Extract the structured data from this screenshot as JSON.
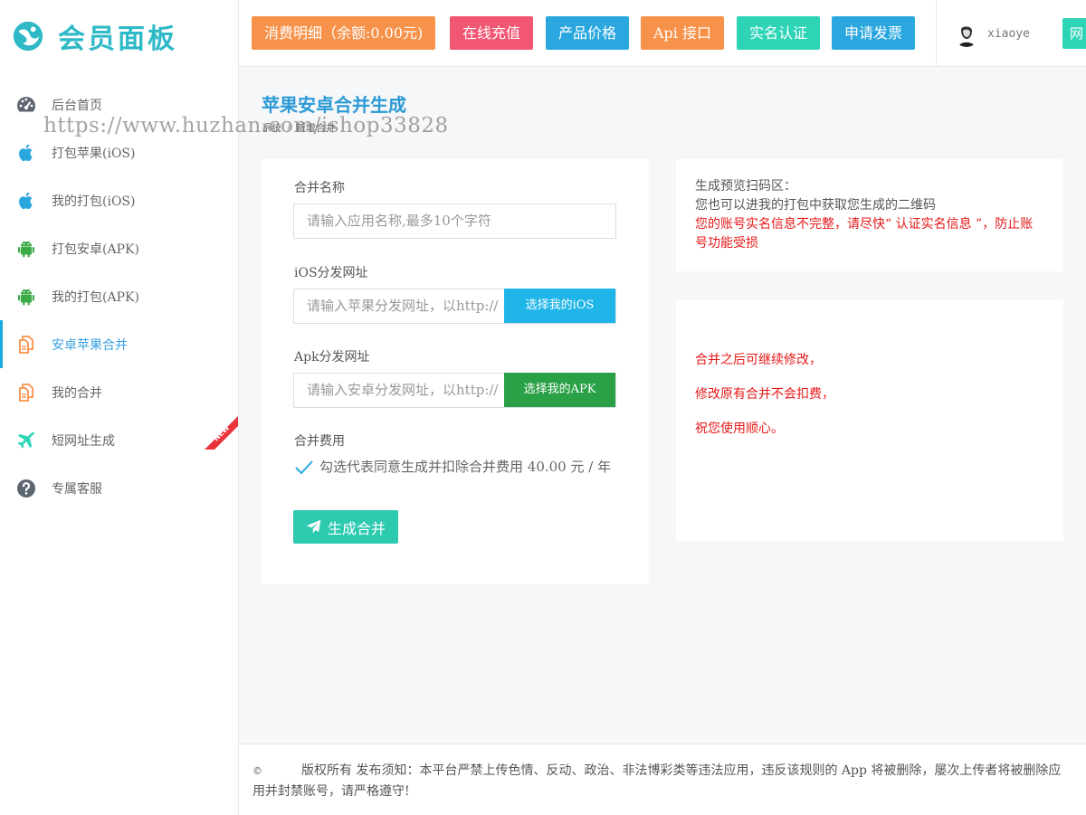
{
  "brand": {
    "title": "会员面板",
    "color": "#2fb9c7"
  },
  "watermark": "https://www.huzhan.com/ishop33828",
  "sidebar": {
    "items": [
      {
        "label": "后台首页",
        "icon": "dashboard-icon"
      },
      {
        "label": "打包苹果(iOS)",
        "icon": "apple-icon"
      },
      {
        "label": "我的打包(iOS)",
        "icon": "apple-icon"
      },
      {
        "label": "打包安卓(APK)",
        "icon": "android-icon"
      },
      {
        "label": "我的打包(APK)",
        "icon": "android-icon"
      },
      {
        "label": "安卓苹果合并",
        "icon": "merge-copy-icon",
        "active": true
      },
      {
        "label": "我的合并",
        "icon": "merge-copy-icon"
      },
      {
        "label": "短网址生成",
        "icon": "plane-icon",
        "badge": "NEW"
      },
      {
        "label": "专属客服",
        "icon": "help-circle-icon"
      }
    ]
  },
  "header": {
    "buttons": [
      {
        "label": "消费明细（余额:0.00元)",
        "color": "#f7924a"
      },
      {
        "label": "在线充值",
        "color": "#f15672"
      },
      {
        "label": "产品价格",
        "color": "#2aa7de"
      },
      {
        "label": "Api 接口",
        "color": "#f7924a"
      },
      {
        "label": "实名认证",
        "color": "#2ed4b6"
      },
      {
        "label": "申请发票",
        "color": "#2aa7de"
      }
    ],
    "username": "xiaoye",
    "cut_button": "网"
  },
  "page": {
    "title": "苹果安卓合并生成",
    "breadcrumb": [
      "系统",
      "新增合并"
    ]
  },
  "form": {
    "name_label": "合并名称",
    "name_placeholder": "请输入应用名称,最多10个字符",
    "ios_label": "iOS分发网址",
    "ios_placeholder": "请输入苹果分发网址，以http://",
    "ios_button": "选择我的iOS",
    "apk_label": "Apk分发网址",
    "apk_placeholder": "请输入安卓分发网址，以http://",
    "apk_button": "选择我的APK",
    "fee_label": "合并费用",
    "agree_text": "勾选代表同意生成并扣除合并费用 40.00 元 / 年",
    "submit_label": "生成合并"
  },
  "preview": {
    "line1": "生成预览扫码区：",
    "line2": "您也可以进我的打包中获取您生成的二维码",
    "warning": "您的账号实名信息不完整，请尽快“ 认证实名信息 ”，防止账号功能受损"
  },
  "tips": [
    "合并之后可继续修改，",
    "修改原有合并不会扣费，",
    "祝您使用顺心。"
  ],
  "footer": {
    "copyright": "©",
    "text": "版权所有 发布须知：本平台严禁上传色情、反动、政治、非法博彩类等违法应用，违反该规则的 App 将被删除，屡次上传者将被删除应用并封禁账号，请严格遵守!"
  }
}
